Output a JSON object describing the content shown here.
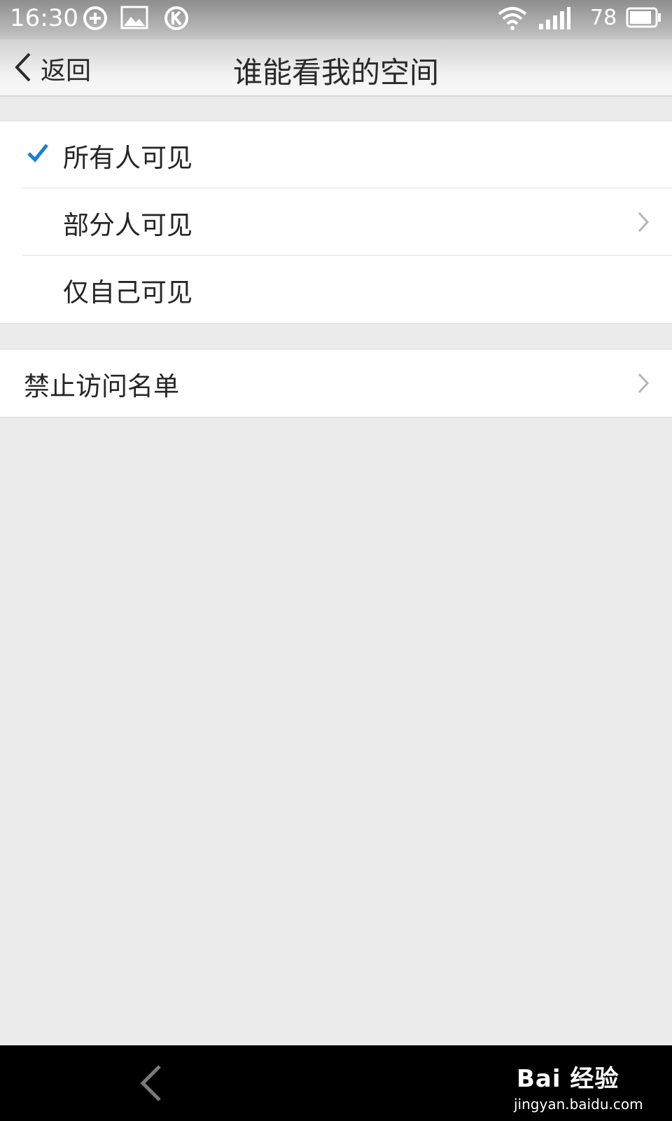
{
  "status_bar": {
    "time": "16:30",
    "battery_level": "78",
    "icons": [
      "sync-icon",
      "image-icon",
      "k-icon",
      "wifi-icon",
      "signal-icon",
      "battery-icon"
    ]
  },
  "header": {
    "back_label": "返回",
    "title": "谁能看我的空间"
  },
  "visibility_options": [
    {
      "label": "所有人可见",
      "selected": true,
      "has_chevron": false
    },
    {
      "label": "部分人可见",
      "selected": false,
      "has_chevron": true
    },
    {
      "label": "仅自己可见",
      "selected": false,
      "has_chevron": false
    }
  ],
  "blocked_list": {
    "label": "禁止访问名单",
    "has_chevron": true
  },
  "watermark": {
    "brand": "Bai 经验",
    "url": "jingyan.baidu.com"
  },
  "colors": {
    "accent": "#1a7fd6",
    "background": "#ebebeb",
    "text": "#262626",
    "chevron": "#b5b5b5"
  }
}
